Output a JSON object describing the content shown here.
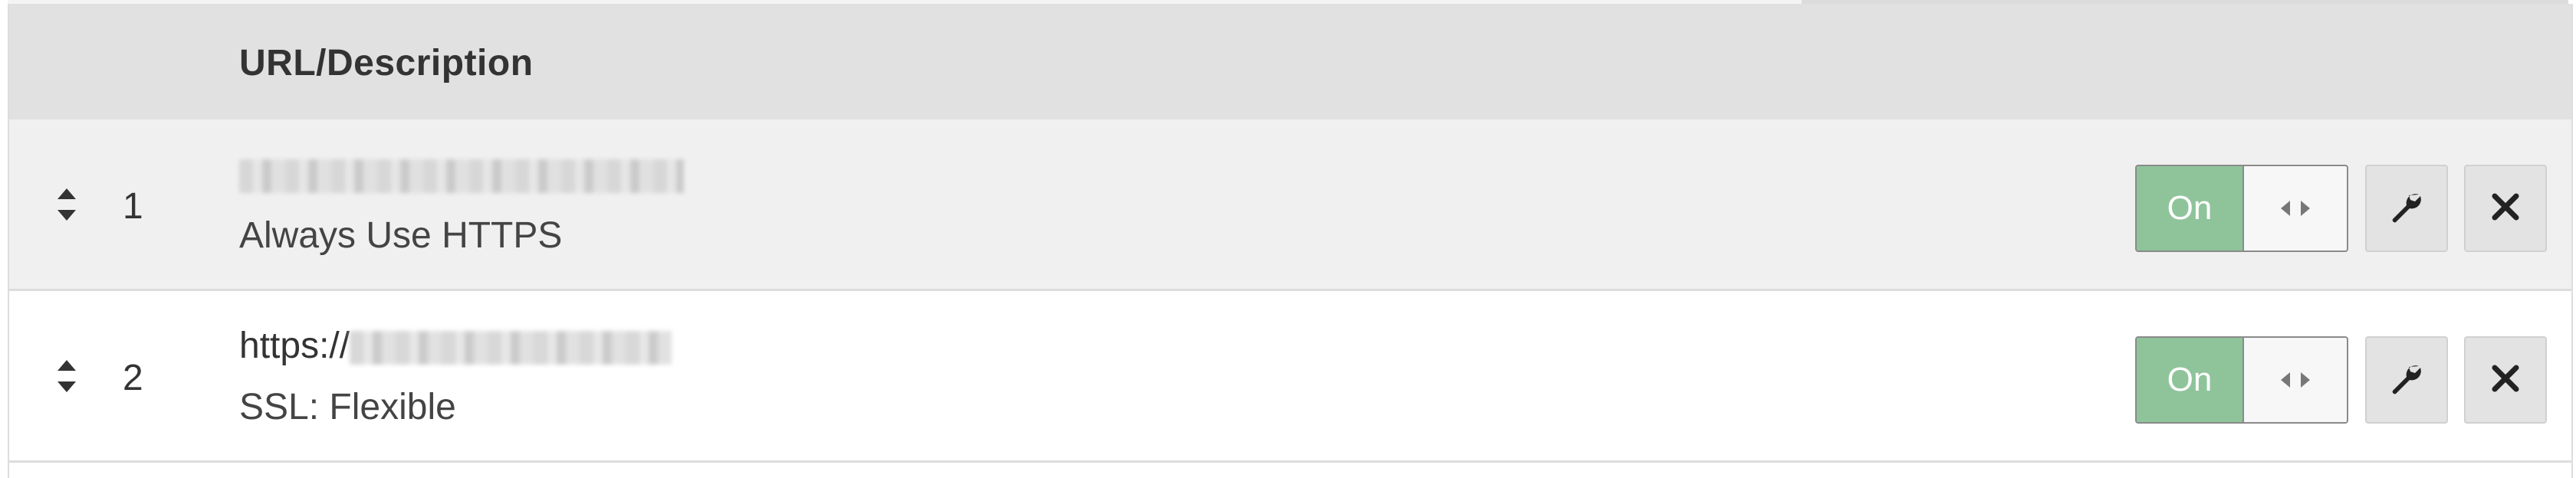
{
  "table": {
    "column_header": "URL/Description"
  },
  "rows": [
    {
      "number": "1",
      "url_prefix": "",
      "description": "Always Use HTTPS",
      "toggle_label": "On"
    },
    {
      "number": "2",
      "url_prefix": "https://",
      "description": "SSL: Flexible",
      "toggle_label": "On"
    }
  ],
  "icons": {
    "sort": "sort-arrows-icon",
    "toggle_handle": "left-right-arrows-icon",
    "edit": "wrench-icon",
    "delete": "close-icon"
  },
  "colors": {
    "header_bg": "#e1e1e1",
    "toggle_on": "#8fc49b",
    "row_alt_bg": "#f0f0f0"
  }
}
